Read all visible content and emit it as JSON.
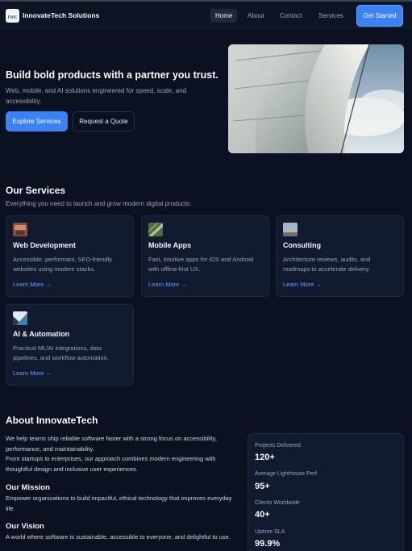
{
  "nav": {
    "logo_alt": "Innc",
    "brand": "InnovateTech Solutions",
    "links": [
      {
        "label": "Home",
        "active": true
      },
      {
        "label": "About",
        "active": false
      },
      {
        "label": "Contact",
        "active": false
      },
      {
        "label": "Services",
        "active": false
      }
    ],
    "cta_label": "Get Started"
  },
  "hero": {
    "title": "Build bold products with a partner you trust.",
    "subtitle": "Web, mobile, and AI solutions engineered for speed, scale, and accessibility.",
    "primary_button": "Explore Services",
    "secondary_button": "Request a Quote"
  },
  "services": {
    "title": "Our Services",
    "subtitle": "Everything you need to launch and grow modern digital products.",
    "cards": [
      {
        "title": "Web Development",
        "description": "Accessible, performant, SEO-friendly websites using modern stacks.",
        "link": "Learn More →"
      },
      {
        "title": "Mobile Apps",
        "description": "Fast, intuitive apps for iOS and Android with offline-first UX.",
        "link": "Learn More →"
      },
      {
        "title": "Consulting",
        "description": "Architecture reviews, audits, and roadmaps to accelerate delivery.",
        "link": "Learn More →"
      },
      {
        "title": "AI & Automation",
        "description": "Practical ML/AI integrations, data pipelines, and workflow automation.",
        "link": "Learn More →"
      }
    ]
  },
  "about": {
    "title": "About InnovateTech",
    "paragraph1": "We help teams ship reliable software faster with a strong focus on accessibility, performance, and maintainability.",
    "paragraph2": "From startups to enterprises, our approach combines modern engineering with thoughtful design and inclusive user experiences.",
    "mission_heading": "Our Mission",
    "mission_text": "Empower organizations to build impactful, ethical technology that improves everyday life.",
    "vision_heading": "Our Vision",
    "vision_text": "A world where software is sustainable, accessible to everyone, and delightful to use."
  },
  "stats": [
    {
      "label": "Projects Delivered",
      "value": "120+"
    },
    {
      "label": "Average Lighthouse Perf",
      "value": "95+"
    },
    {
      "label": "Clients Worldwide",
      "value": "40+"
    },
    {
      "label": "Uptime SLA",
      "value": "99.9%"
    }
  ],
  "colors": {
    "background": "#0b1120",
    "accent": "#3b82f6",
    "link": "#60a5fa",
    "card": "#111a2e"
  }
}
